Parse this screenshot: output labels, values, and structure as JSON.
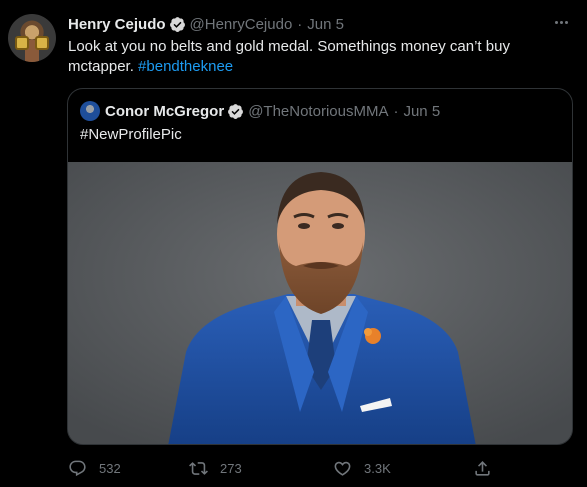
{
  "tweet": {
    "author_name": "Henry Cejudo",
    "author_handle": "@HenryCejudo",
    "separator": "·",
    "date": "Jun 5",
    "text_main": "Look at you no belts and gold medal. Somethings money can’t buy mctapper.",
    "hashtag": "#bendtheknee",
    "avatar_icon": "avatar-with-belts"
  },
  "quoted": {
    "author_name": "Conor McGregor",
    "author_handle": "@TheNotoriousMMA",
    "separator": "·",
    "date": "Jun 5",
    "text": "#NewProfilePic"
  },
  "actions": {
    "reply_count": "532",
    "retweet_count": "273",
    "like_count": "3.3K"
  },
  "colors": {
    "background": "#000000",
    "text": "#e7e9ea",
    "muted": "#71767b",
    "link": "#1d9bf0",
    "border": "#2f3336",
    "verified": "#d9d9d9"
  }
}
